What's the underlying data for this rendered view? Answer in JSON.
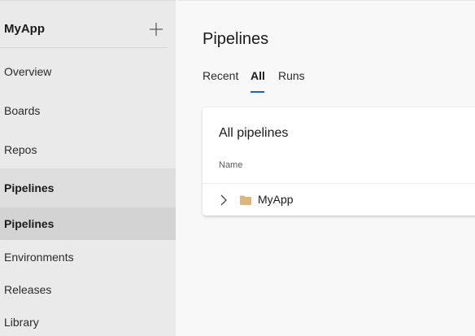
{
  "sidebar": {
    "project_name": "MyApp",
    "add_icon": "plus-icon",
    "items": [
      {
        "label": "Overview"
      },
      {
        "label": "Boards"
      },
      {
        "label": "Repos"
      },
      {
        "label": "Pipelines"
      },
      {
        "label": "Pipelines"
      },
      {
        "label": "Environments"
      },
      {
        "label": "Releases"
      },
      {
        "label": "Library"
      }
    ]
  },
  "main": {
    "title": "Pipelines",
    "tabs": [
      {
        "label": "Recent"
      },
      {
        "label": "All"
      },
      {
        "label": "Runs"
      }
    ],
    "active_tab": "All",
    "card": {
      "title": "All pipelines",
      "column_header": "Name",
      "rows": [
        {
          "label": "MyApp",
          "icon": "folder-icon",
          "expander_icon": "chevron-right-icon"
        }
      ]
    }
  },
  "colors": {
    "sidebar_bg": "#eaeaea",
    "selected_bg": "#d3d3d3",
    "accent": "#0f6cbd",
    "folder": "#dcb67a"
  }
}
